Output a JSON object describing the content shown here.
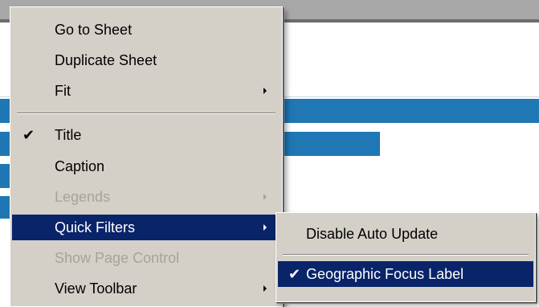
{
  "background_colors": {
    "top_bar": "#a8a8a8",
    "bar_fill": "#1f77b4"
  },
  "context_menu": {
    "items": [
      {
        "label": "Go to Sheet",
        "checked": false,
        "disabled": false,
        "submenu": false
      },
      {
        "label": "Duplicate Sheet",
        "checked": false,
        "disabled": false,
        "submenu": false
      },
      {
        "label": "Fit",
        "checked": false,
        "disabled": false,
        "submenu": true
      },
      {
        "label": "Title",
        "checked": true,
        "disabled": false,
        "submenu": false
      },
      {
        "label": "Caption",
        "checked": false,
        "disabled": false,
        "submenu": false
      },
      {
        "label": "Legends",
        "checked": false,
        "disabled": true,
        "submenu": true
      },
      {
        "label": "Quick Filters",
        "checked": false,
        "disabled": false,
        "submenu": true,
        "highlighted": true
      },
      {
        "label": "Show Page Control",
        "checked": false,
        "disabled": true,
        "submenu": false
      },
      {
        "label": "View Toolbar",
        "checked": false,
        "disabled": false,
        "submenu": true
      }
    ],
    "check_glyph": "✔"
  },
  "submenu": {
    "items": [
      {
        "label": "Disable Auto Update",
        "checked": false
      },
      {
        "label": "Geographic Focus Label",
        "checked": true,
        "highlighted": true
      }
    ]
  },
  "colors": {
    "menu_bg": "#d4d0c8",
    "highlight_bg": "#0a246a",
    "disabled_text": "#a6a39b"
  }
}
